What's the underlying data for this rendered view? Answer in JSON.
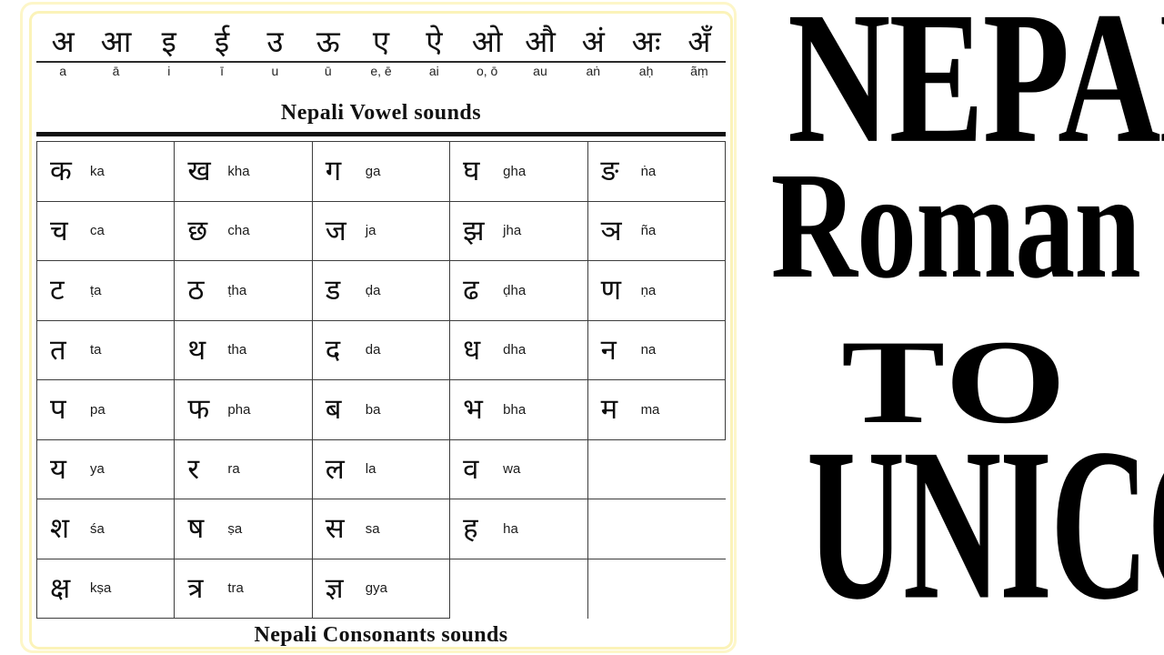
{
  "title_block": {
    "line1": "NEPALI",
    "line2": "Roman",
    "line3": "TO",
    "line4": "UNICODE"
  },
  "chart": {
    "border_color": "#fbf3b9",
    "vowel_caption": "Nepali Vowel sounds",
    "consonant_caption": "Nepali Consonants sounds",
    "vowels": [
      {
        "devanagari": "अ",
        "roman": "a"
      },
      {
        "devanagari": "आ",
        "roman": "ā"
      },
      {
        "devanagari": "इ",
        "roman": "i"
      },
      {
        "devanagari": "ई",
        "roman": "ī"
      },
      {
        "devanagari": "उ",
        "roman": "u"
      },
      {
        "devanagari": "ऊ",
        "roman": "ū"
      },
      {
        "devanagari": "ए",
        "roman": "e, ē"
      },
      {
        "devanagari": "ऐ",
        "roman": "ai"
      },
      {
        "devanagari": "ओ",
        "roman": "o, ō"
      },
      {
        "devanagari": "औ",
        "roman": "au"
      },
      {
        "devanagari": "अं",
        "roman": "aṅ"
      },
      {
        "devanagari": "अः",
        "roman": "aḥ"
      },
      {
        "devanagari": "अँ",
        "roman": "ãṃ"
      }
    ],
    "consonant_rows": [
      [
        {
          "devanagari": "क",
          "roman": "ka"
        },
        {
          "devanagari": "ख",
          "roman": "kha"
        },
        {
          "devanagari": "ग",
          "roman": "ga"
        },
        {
          "devanagari": "घ",
          "roman": "gha"
        },
        {
          "devanagari": "ङ",
          "roman": "ṅa"
        }
      ],
      [
        {
          "devanagari": "च",
          "roman": "ca"
        },
        {
          "devanagari": "छ",
          "roman": "cha"
        },
        {
          "devanagari": "ज",
          "roman": "ja"
        },
        {
          "devanagari": "झ",
          "roman": "jha"
        },
        {
          "devanagari": "ञ",
          "roman": "ña"
        }
      ],
      [
        {
          "devanagari": "ट",
          "roman": "ṭa"
        },
        {
          "devanagari": "ठ",
          "roman": "ṭha"
        },
        {
          "devanagari": "ड",
          "roman": "ḍa"
        },
        {
          "devanagari": "ढ",
          "roman": "ḍha"
        },
        {
          "devanagari": "ण",
          "roman": "ṇa"
        }
      ],
      [
        {
          "devanagari": "त",
          "roman": "ta"
        },
        {
          "devanagari": "थ",
          "roman": "tha"
        },
        {
          "devanagari": "द",
          "roman": "da"
        },
        {
          "devanagari": "ध",
          "roman": "dha"
        },
        {
          "devanagari": "न",
          "roman": "na"
        }
      ],
      [
        {
          "devanagari": "प",
          "roman": "pa"
        },
        {
          "devanagari": "फ",
          "roman": "pha"
        },
        {
          "devanagari": "ब",
          "roman": "ba"
        },
        {
          "devanagari": "भ",
          "roman": "bha"
        },
        {
          "devanagari": "म",
          "roman": "ma"
        }
      ],
      [
        {
          "devanagari": "य",
          "roman": "ya"
        },
        {
          "devanagari": "र",
          "roman": "ra"
        },
        {
          "devanagari": "ल",
          "roman": "la"
        },
        {
          "devanagari": "व",
          "roman": "wa"
        },
        {
          "devanagari": "",
          "roman": ""
        }
      ],
      [
        {
          "devanagari": "श",
          "roman": "śa"
        },
        {
          "devanagari": "ष",
          "roman": "ṣa"
        },
        {
          "devanagari": "स",
          "roman": "sa"
        },
        {
          "devanagari": "ह",
          "roman": "ha"
        },
        {
          "devanagari": "",
          "roman": ""
        }
      ],
      [
        {
          "devanagari": "क्ष",
          "roman": "kṣa"
        },
        {
          "devanagari": "त्र",
          "roman": "tra"
        },
        {
          "devanagari": "ज्ञ",
          "roman": "gya"
        },
        {
          "devanagari": "",
          "roman": ""
        },
        {
          "devanagari": "",
          "roman": ""
        }
      ]
    ]
  }
}
